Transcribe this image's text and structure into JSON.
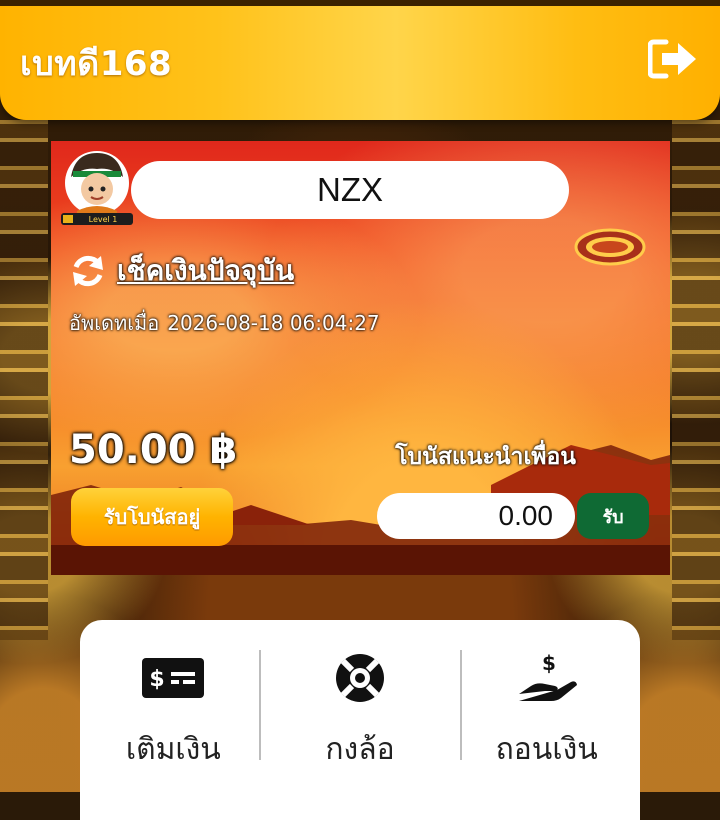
{
  "header": {
    "brand": "เบทดี168",
    "logout_icon": "sign-out-icon"
  },
  "card": {
    "username": "NZX",
    "avatar_level_text": "Level 1",
    "check_balance_label": "เช็คเงินปัจจุบัน",
    "updated_prefix": "อัพเดทเมื่อ",
    "updated_at": "2026-08-18 06:04:27",
    "balance": "50.00 ฿",
    "bonus_button": "รับโบนัสอยู่",
    "referral_label": "โบนัสแนะนำเพื่อน",
    "referral_value": "0.00",
    "receive_button": "รับ"
  },
  "menu": {
    "items": [
      {
        "label": "เติมเงิน",
        "icon": "deposit-cash-icon"
      },
      {
        "label": "กงล้อ",
        "icon": "lifebuoy-wheel-icon"
      },
      {
        "label": "ถอนเงิน",
        "icon": "withdraw-hand-icon"
      }
    ]
  },
  "colors": {
    "header": "#ffc21a",
    "receive_button": "#0f6a34",
    "bonus_button": "#ffb300"
  }
}
